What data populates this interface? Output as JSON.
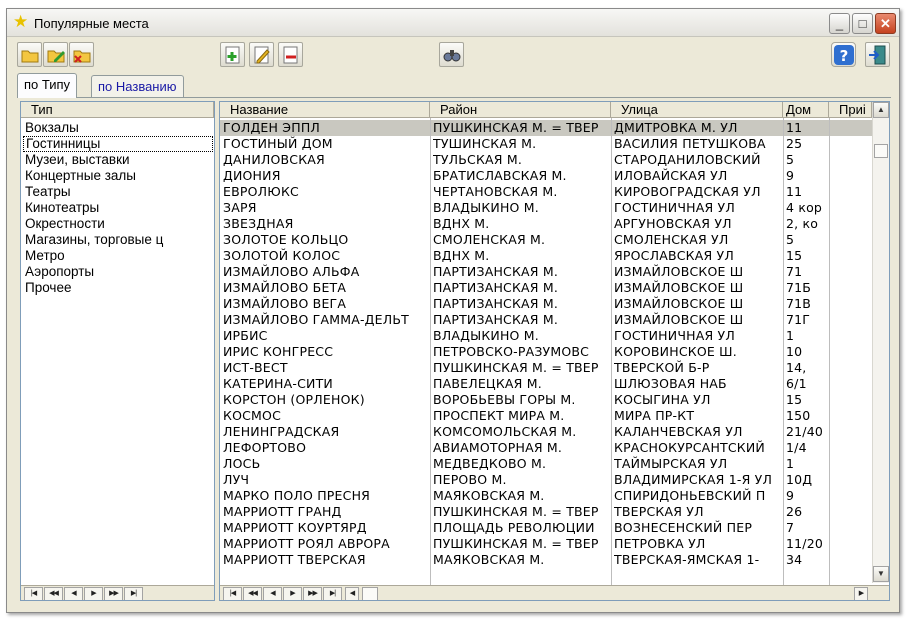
{
  "window": {
    "title": "Популярные места"
  },
  "toolbar": {
    "left_buttons": [
      "open-folder-icon",
      "edit-folder-icon",
      "delete-folder-icon"
    ],
    "middle_buttons": [
      "add-record-icon",
      "edit-record-icon",
      "delete-record-icon"
    ],
    "search_button": "binoculars-icon",
    "help_button": "help-icon",
    "exit_button": "exit-door-icon"
  },
  "tabs": [
    {
      "label": "по Типу",
      "active": true
    },
    {
      "label": "по Названию",
      "active": false
    }
  ],
  "types": {
    "header": "Тип",
    "items": [
      "Вокзалы",
      "Гостинницы",
      "Музеи, выставки",
      "Концертные залы",
      "Театры",
      "Кинотеатры",
      "Окрестности",
      "Магазины, торговые ц",
      "Метро",
      "Аэропорты",
      "Прочее"
    ],
    "selected_index": 1
  },
  "places": {
    "columns": [
      "Название",
      "Район",
      "Улица",
      "Дом",
      "Приі"
    ],
    "selected_index": 0,
    "rows": [
      [
        "ГОЛДЕН ЭППЛ",
        "ПУШКИНСКАЯ М. = ТВЕР",
        "ДМИТРОВКА М. УЛ",
        "11"
      ],
      [
        "ГОСТИНЫЙ ДОМ",
        "ТУШИНСКАЯ М.",
        "ВАСИЛИЯ ПЕТУШКОВА",
        "25"
      ],
      [
        "ДАНИЛОВСКАЯ",
        "ТУЛЬСКАЯ М.",
        "СТАРОДАНИЛОВСКИЙ",
        "5"
      ],
      [
        "ДИОНИЯ",
        "БРАТИСЛАВСКАЯ М.",
        "ИЛОВАЙСКАЯ УЛ",
        "9"
      ],
      [
        "ЕВРОЛЮКС",
        "ЧЕРТАНОВСКАЯ М.",
        "КИРОВОГРАДСКАЯ УЛ",
        "11"
      ],
      [
        "ЗАРЯ",
        "ВЛАДЫКИНО М.",
        "ГОСТИНИЧНАЯ УЛ",
        "4 кор"
      ],
      [
        "ЗВЕЗДНАЯ",
        "ВДНХ М.",
        "АРГУНОВСКАЯ УЛ",
        "2, ко"
      ],
      [
        "ЗОЛОТОЕ КОЛЬЦО",
        "СМОЛЕНСКАЯ М.",
        "СМОЛЕНСКАЯ УЛ",
        "5"
      ],
      [
        "ЗОЛОТОЙ КОЛОС",
        "ВДНХ М.",
        "ЯРОСЛАВСКАЯ УЛ",
        "15"
      ],
      [
        "ИЗМАЙЛОВО АЛЬФА",
        "ПАРТИЗАНСКАЯ М.",
        "ИЗМАЙЛОВСКОЕ Ш",
        "71"
      ],
      [
        "ИЗМАЙЛОВО БЕТА",
        "ПАРТИЗАНСКАЯ М.",
        "ИЗМАЙЛОВСКОЕ Ш",
        "71Б"
      ],
      [
        "ИЗМАЙЛОВО ВЕГА",
        "ПАРТИЗАНСКАЯ М.",
        "ИЗМАЙЛОВСКОЕ Ш",
        "71В"
      ],
      [
        "ИЗМАЙЛОВО ГАММА-ДЕЛЬТ",
        "ПАРТИЗАНСКАЯ М.",
        "ИЗМАЙЛОВСКОЕ Ш",
        "71Г"
      ],
      [
        "ИРБИС",
        "ВЛАДЫКИНО М.",
        "ГОСТИНИЧНАЯ УЛ",
        "1"
      ],
      [
        "ИРИС КОНГРЕСС",
        "ПЕТРОВСКО-РАЗУМОВС",
        "КОРОВИНСКОЕ Ш.",
        "10"
      ],
      [
        "ИСТ-ВЕСТ",
        "ПУШКИНСКАЯ М. = ТВЕР",
        "ТВЕРСКОЙ Б-Р",
        "14,"
      ],
      [
        "КАТЕРИНА-СИТИ",
        "ПАВЕЛЕЦКАЯ М.",
        "ШЛЮЗОВАЯ НАБ",
        "6/1"
      ],
      [
        "КОРСТОН (ОРЛЕНОК)",
        "ВОРОБЬЕВЫ ГОРЫ М.",
        "КОСЫГИНА УЛ",
        "15"
      ],
      [
        "КОСМОС",
        "ПРОСПЕКТ МИРА М.",
        "МИРА ПР-КТ",
        "150"
      ],
      [
        "ЛЕНИНГРАДСКАЯ",
        "КОМСОМОЛЬСКАЯ М.",
        "КАЛАНЧЕВСКАЯ УЛ",
        "21/40"
      ],
      [
        "ЛЕФОРТОВО",
        "АВИАМОТОРНАЯ М.",
        "КРАСНОКУРСАНТСКИЙ",
        "1/4"
      ],
      [
        "ЛОСЬ",
        "МЕДВЕДКОВО М.",
        "ТАЙМЫРСКАЯ УЛ",
        "1"
      ],
      [
        "ЛУЧ",
        "ПЕРОВО М.",
        "ВЛАДИМИРСКАЯ 1-Я УЛ",
        "10Д"
      ],
      [
        "МАРКО ПОЛО ПРЕСНЯ",
        "МАЯКОВСКАЯ М.",
        "СПИРИДОНЬЕВСКИЙ П",
        "9"
      ],
      [
        "МАРРИОТТ ГРАНД",
        "ПУШКИНСКАЯ М. = ТВЕР",
        "ТВЕРСКАЯ УЛ",
        "26"
      ],
      [
        "МАРРИОТТ КОУРТЯРД",
        "ПЛОЩАДЬ РЕВОЛЮЦИИ",
        "ВОЗНЕСЕНСКИЙ ПЕР",
        "7"
      ],
      [
        "МАРРИОТТ РОЯЛ АВРОРА",
        "ПУШКИНСКАЯ М. = ТВЕР",
        "ПЕТРОВКА УЛ",
        "11/20"
      ],
      [
        "МАРРИОТТ ТВЕРСКАЯ",
        "МАЯКОВСКАЯ М.",
        "ТВЕРСКАЯ-ЯМСКАЯ 1-",
        "34"
      ]
    ]
  },
  "navigator": {
    "buttons": [
      "first",
      "prev-page",
      "prev",
      "next",
      "next-page",
      "last"
    ]
  },
  "colors": {
    "selection_row": "#c9c8c0",
    "header_bg": "#ece9d8",
    "window_bg": "#ece9d8",
    "close_red": "#c5421f"
  }
}
